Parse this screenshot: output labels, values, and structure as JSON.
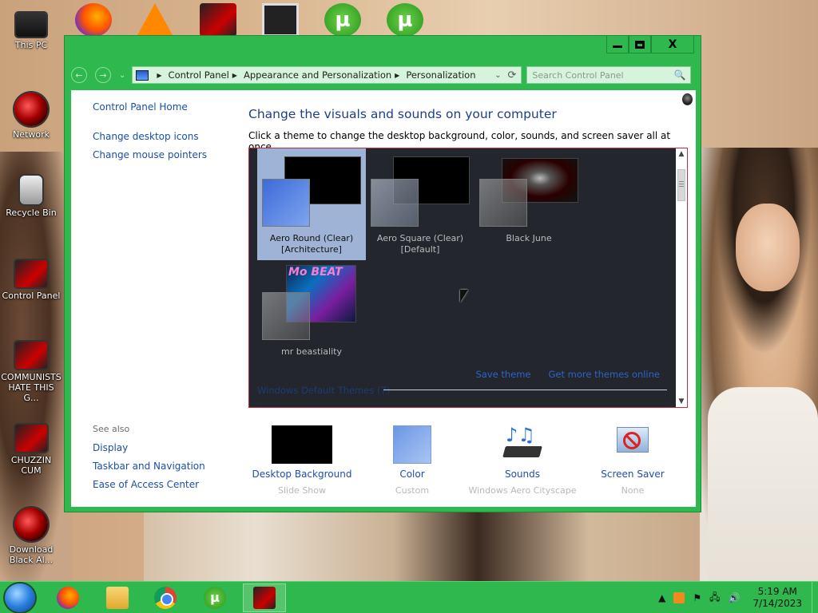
{
  "desktop": {
    "icons": [
      {
        "label": "This PC",
        "glyph": "computer-icon"
      },
      {
        "label": "Network",
        "glyph": "network-icon"
      },
      {
        "label": "Recycle Bin",
        "glyph": "recycle-bin-icon"
      },
      {
        "label": "Control Panel",
        "glyph": "control-panel-icon"
      },
      {
        "label": "COMMUNISTS HATE THIS G...",
        "glyph": "shortcut-icon"
      },
      {
        "label": "CHUZZIN CUM",
        "glyph": "shortcut-icon"
      },
      {
        "label": "Download Black Al...",
        "glyph": "shortcut-icon"
      }
    ]
  },
  "window": {
    "controls": {
      "minimize": "—",
      "maximize": "□",
      "close": "X"
    },
    "nav": {
      "back": "←",
      "forward": "→",
      "recent": "⌄"
    },
    "address": {
      "crumbs": [
        "Control Panel",
        "Appearance and Personalization",
        "Personalization"
      ],
      "separator": "▶"
    },
    "search": {
      "placeholder": "Search Control Panel",
      "icon": "🔍"
    },
    "sidebar": {
      "home": "Control Panel Home",
      "items": [
        "Change desktop icons",
        "Change mouse pointers"
      ]
    },
    "see_also": {
      "label": "See also",
      "items": [
        "Display",
        "Taskbar and Navigation",
        "Ease of Access Center"
      ]
    },
    "title": "Change the visuals and sounds on your computer",
    "subtitle": "Click a theme to change the desktop background, color, sounds, and screen saver all at once.",
    "themes": [
      {
        "name": "Aero Round (Clear)",
        "sub": "[Architecture]",
        "selected": true
      },
      {
        "name": "Aero Square (Clear)",
        "sub": "[Default]",
        "selected": false
      },
      {
        "name": "Black June",
        "sub": "",
        "selected": false
      },
      {
        "name": "mr beastiality",
        "sub": "",
        "selected": false
      }
    ],
    "theme_art": {
      "mr_beat_title": "Mo BEAT"
    },
    "theme_links": {
      "save": "Save theme",
      "online": "Get more themes online"
    },
    "windows_default": "Windows Default Themes (7)",
    "bottom": {
      "desktop_background": {
        "title": "Desktop Background",
        "sub": "Slide Show"
      },
      "color": {
        "title": "Color",
        "sub": "Custom"
      },
      "sounds": {
        "title": "Sounds",
        "sub": "Windows Aero Cityscape"
      },
      "screen_saver": {
        "title": "Screen Saver",
        "sub": "None"
      }
    }
  },
  "taskbar": {
    "tray": {
      "chevron": "▲",
      "flag": "⚑",
      "network": "🖧",
      "volume": "🔊"
    },
    "clock": {
      "time": "5:19 AM",
      "date": "7/14/2023"
    }
  }
}
